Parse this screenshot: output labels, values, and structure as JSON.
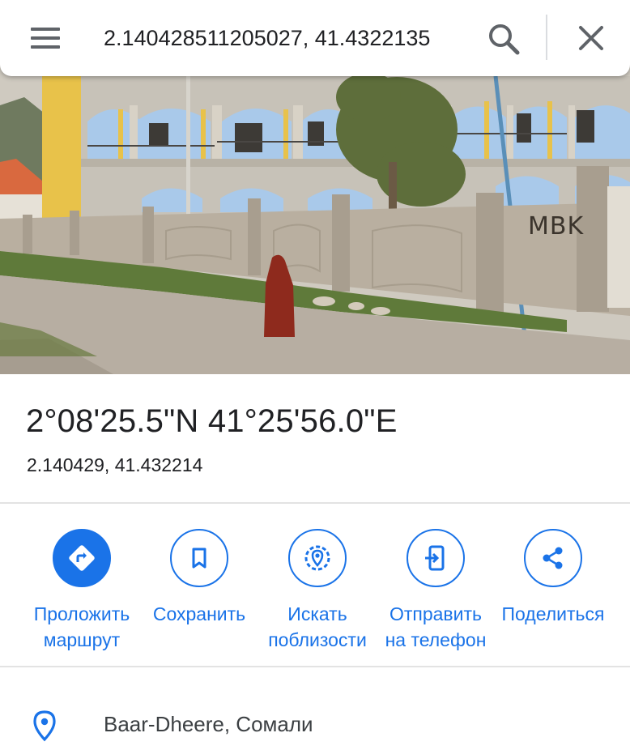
{
  "search": {
    "query": "2.140428511205027, 41.4322135",
    "menu_icon": "hamburger-menu-icon",
    "search_icon": "search-icon",
    "close_icon": "close-icon"
  },
  "photo": {
    "wall_graffiti": "MBK"
  },
  "place": {
    "coords_dms": "2°08'25.5\"N 41°25'56.0\"E",
    "coords_decimal": "2.140429, 41.432214"
  },
  "actions": [
    {
      "label": "Проложить\nмаршрут",
      "icon": "directions-icon"
    },
    {
      "label": "Сохранить",
      "icon": "bookmark-icon"
    },
    {
      "label": "Искать\nпоблизости",
      "icon": "nearby-search-icon"
    },
    {
      "label": "Отправить\nна телефон",
      "icon": "send-to-phone-icon"
    },
    {
      "label": "Поделиться",
      "icon": "share-icon"
    }
  ],
  "address": {
    "text": "Baar-Dheere, Сомали",
    "icon": "location-pin-icon"
  },
  "colors": {
    "accent": "#1a73e8",
    "text_primary": "#202124",
    "icon_gray": "#5f6368",
    "divider": "#e3e3e3"
  }
}
